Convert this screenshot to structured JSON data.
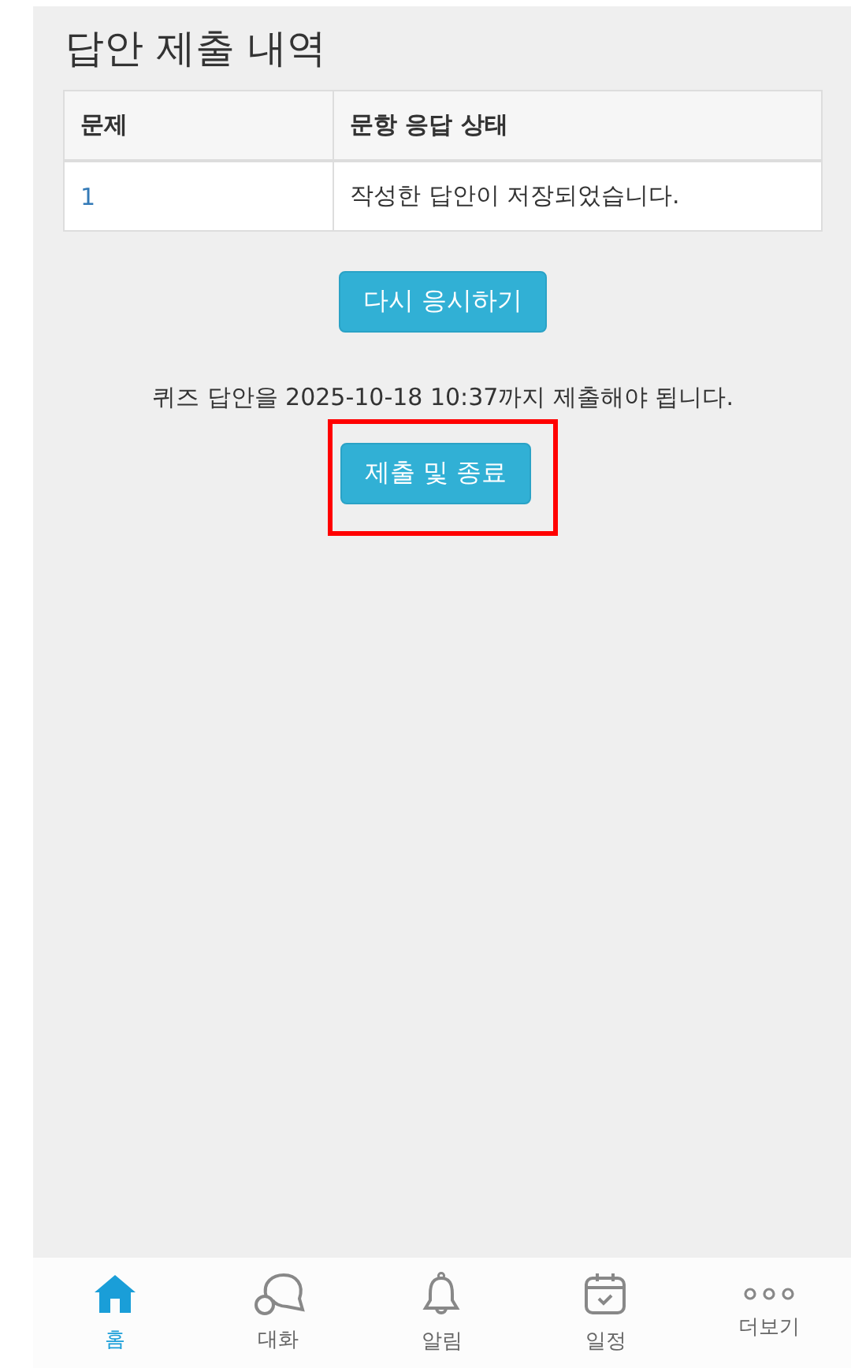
{
  "title": "답안 제출 내역",
  "table": {
    "columns": [
      "문제",
      "문항 응답 상태"
    ],
    "rows": [
      {
        "number": "1",
        "status": "작성한 답안이 저장되었습니다."
      }
    ]
  },
  "retry_button": "다시 응시하기",
  "deadline_notice": "퀴즈 답안을 2025-10-18 10:37까지 제출해야 됩니다.",
  "submit_button": {
    "label": "제출 및 종료",
    "highlighted": true
  },
  "nav": [
    {
      "kind": "home",
      "label": "홈",
      "selected": true
    },
    {
      "kind": "chat",
      "label": "대화",
      "selected": false
    },
    {
      "kind": "bell",
      "label": "알림",
      "selected": false
    },
    {
      "kind": "calendar",
      "label": "일정",
      "selected": false
    },
    {
      "kind": "more",
      "label": "더보기",
      "selected": false
    }
  ]
}
